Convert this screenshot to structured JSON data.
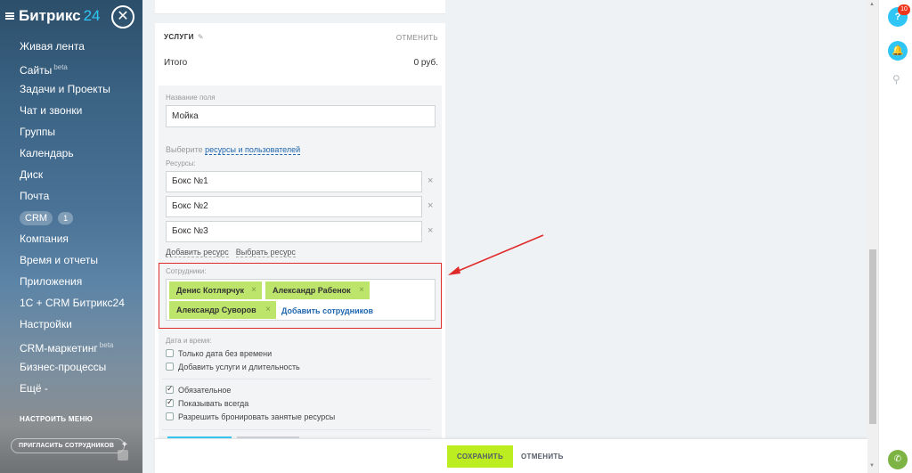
{
  "sidebar": {
    "logo_name": "Битрикс",
    "logo_num": "24",
    "close_symbol": "✕",
    "items": [
      {
        "label": "Живая лента",
        "sup": ""
      },
      {
        "label": "Сайты",
        "sup": "beta"
      },
      {
        "label": "Задачи и Проекты",
        "sup": ""
      },
      {
        "label": "Чат и звонки",
        "sup": ""
      },
      {
        "label": "Группы",
        "sup": ""
      },
      {
        "label": "Календарь",
        "sup": ""
      },
      {
        "label": "Диск",
        "sup": ""
      },
      {
        "label": "Почта",
        "sup": ""
      },
      {
        "label": "CRM",
        "sup": ""
      },
      {
        "label": "Компания",
        "sup": ""
      },
      {
        "label": "Время и отчеты",
        "sup": ""
      },
      {
        "label": "Приложения",
        "sup": ""
      },
      {
        "label": "1С + CRM Битрикс24",
        "sup": ""
      },
      {
        "label": "Настройки",
        "sup": ""
      },
      {
        "label": "CRM-маркетинг",
        "sup": "beta"
      },
      {
        "label": "Бизнес-процессы",
        "sup": ""
      },
      {
        "label": "Ещё -",
        "sup": ""
      }
    ],
    "crm_count": "1",
    "settings_menu": "НАСТРОИТЬ МЕНЮ",
    "invite": "ПРИГЛАСИТЬ СОТРУДНИКОВ"
  },
  "services": {
    "header": "УСЛУГИ",
    "pencil": "✎",
    "cancel": "ОТМЕНИТЬ",
    "total_label": "Итого",
    "total_value": "0 руб."
  },
  "form": {
    "field_name_label": "Название поля",
    "field_name_value": "Мойка",
    "choose_prefix": "Выберите",
    "choose_link": "ресурсы и пользователей",
    "resources_label": "Ресурсы:",
    "resources": [
      "Бокс №1",
      "Бокс №2",
      "Бокс №3"
    ],
    "add_resource": "Добавить ресурс",
    "choose_resource": "Выбрать ресурс",
    "employees_label": "Сотрудники:",
    "employees": [
      "Денис Котлярчук",
      "Александр Рабенок",
      "Александр Суворов"
    ],
    "add_employees": "Добавить сотрудников",
    "datetime_label": "Дата и время:",
    "checks": [
      {
        "label": "Только дата без времени",
        "checked": false
      },
      {
        "label": "Добавить услуги и длительность",
        "checked": false
      },
      {
        "label": "Обязательное",
        "checked": true
      },
      {
        "label": "Показывать всегда",
        "checked": true
      },
      {
        "label": "Разрешить бронировать занятые ресурсы",
        "checked": false
      }
    ]
  },
  "footer": {
    "save": "СОХРАНИТЬ",
    "cancel": "ОТМЕНИТЬ"
  },
  "right_panel": {
    "help_symbol": "?",
    "help_badge": "10"
  },
  "colors": {
    "accent_green": "#bbed21",
    "tag_green": "#bde56c",
    "highlight_red": "#e02a2a",
    "link_blue": "#2067b0"
  }
}
